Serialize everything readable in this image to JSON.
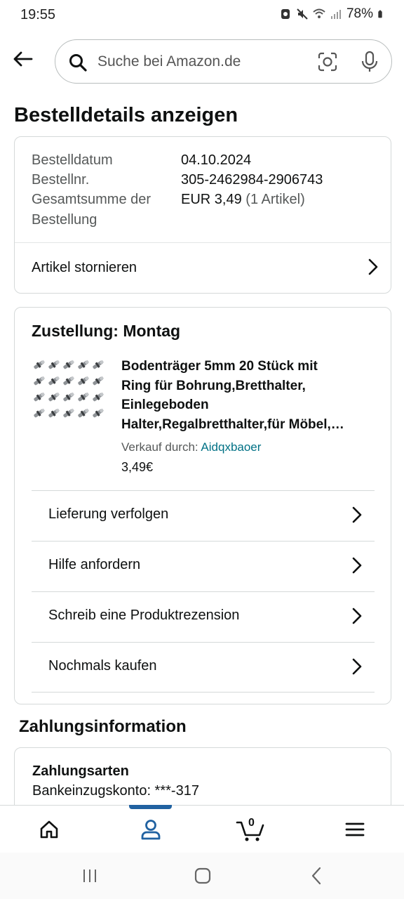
{
  "status_bar": {
    "time": "19:55",
    "battery": "78%"
  },
  "search": {
    "placeholder": "Suche bei Amazon.de"
  },
  "page": {
    "title": "Bestelldetails anzeigen"
  },
  "order": {
    "fields": [
      {
        "label": "Bestelldatum",
        "value": "04.10.2024"
      },
      {
        "label": "Bestellnr.",
        "value": "305-2462984-2906743"
      }
    ],
    "total_label_line1": "Gesamtsumme der",
    "total_label_line2": "Bestellung",
    "total_value": "EUR 3,49",
    "total_items": "(1 Artikel)",
    "cancel_label": "Artikel stornieren"
  },
  "delivery": {
    "title": "Zustellung: Montag",
    "product": {
      "title_lines": [
        "Bodenträger 5mm 20 Stück mit",
        "Ring für Bohrung,Bretthalter,",
        "Einlegeboden",
        "Halter,Regalbretthalter,für Möbel,…"
      ],
      "seller_prefix": "Verkauf durch:",
      "seller_name": "Aidqxbaoer",
      "price": "3,49€"
    },
    "actions": [
      {
        "label": "Lieferung verfolgen"
      },
      {
        "label": "Hilfe anfordern"
      },
      {
        "label": "Schreib eine Produktrezension"
      },
      {
        "label": "Nochmals kaufen"
      }
    ]
  },
  "payment": {
    "section_title": "Zahlungsinformation",
    "methods_heading": "Zahlungsarten",
    "method_value": "Bankeinzugskonto: ***-317"
  },
  "bottom_nav": {
    "cart_count": "0",
    "active_color": "#2162a1"
  },
  "icons": {
    "back": "arrow-left-icon",
    "search": "search-icon",
    "camera": "camera-lens-icon",
    "mic": "microphone-icon",
    "chevron": "chevron-right-icon",
    "home": "home-icon",
    "account": "account-icon",
    "cart": "cart-icon",
    "menu": "hamburger-menu-icon"
  }
}
